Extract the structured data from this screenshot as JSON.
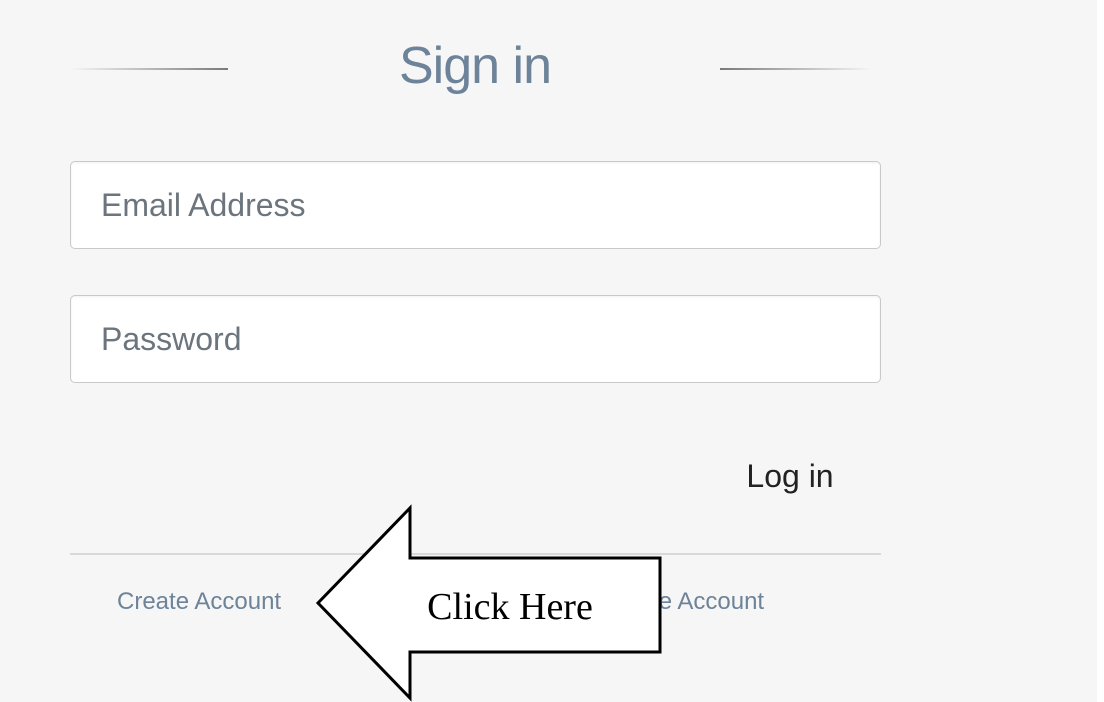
{
  "signin": {
    "title": "Sign in",
    "email_placeholder": "Email Address",
    "password_placeholder": "Password",
    "login_label": "Log in",
    "create_account_label": "Create Account",
    "create_account_label_2": "Create Account"
  },
  "annotation": {
    "callout_text": "Click Here",
    "icon": "left-arrow-callout"
  },
  "colors": {
    "background": "#f6f6f6",
    "title": "#6d8399",
    "link": "#6d8399",
    "input_border": "#c9c9c9",
    "divider": "#d9d9d9"
  }
}
